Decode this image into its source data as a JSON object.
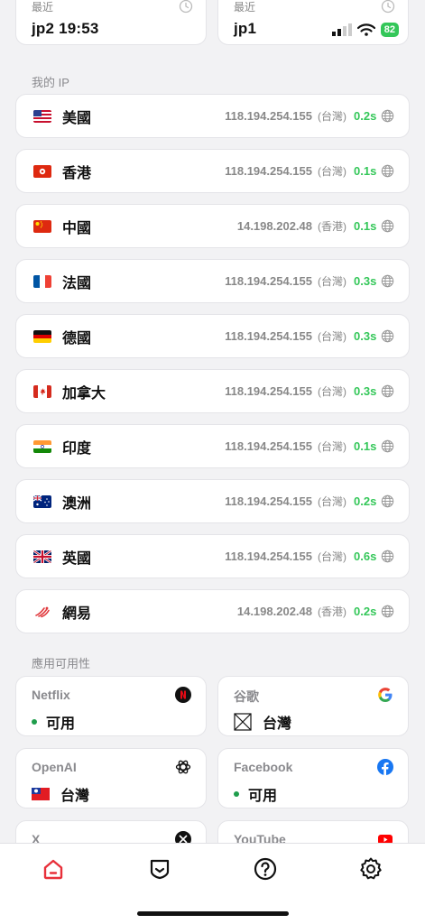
{
  "recent": [
    {
      "label": "最近",
      "main": "jp2 19:53"
    },
    {
      "label": "最近",
      "main": "jp1",
      "battery": "82"
    }
  ],
  "sections": {
    "my_ip": "我的 IP",
    "availability": "應用可用性"
  },
  "ip_rows": [
    {
      "country": "美國",
      "flag": "us-flag-icon",
      "ip": "118.194.254.155",
      "region": "(台灣)",
      "latency": "0.2s"
    },
    {
      "country": "香港",
      "flag": "hk-flag-icon",
      "ip": "118.194.254.155",
      "region": "(台灣)",
      "latency": "0.1s"
    },
    {
      "country": "中國",
      "flag": "cn-flag-icon",
      "ip": "14.198.202.48",
      "region": "(香港)",
      "latency": "0.1s"
    },
    {
      "country": "法國",
      "flag": "fr-flag-icon",
      "ip": "118.194.254.155",
      "region": "(台灣)",
      "latency": "0.3s"
    },
    {
      "country": "德國",
      "flag": "de-flag-icon",
      "ip": "118.194.254.155",
      "region": "(台灣)",
      "latency": "0.3s"
    },
    {
      "country": "加拿大",
      "flag": "ca-flag-icon",
      "ip": "118.194.254.155",
      "region": "(台灣)",
      "latency": "0.3s"
    },
    {
      "country": "印度",
      "flag": "in-flag-icon",
      "ip": "118.194.254.155",
      "region": "(台灣)",
      "latency": "0.1s"
    },
    {
      "country": "澳洲",
      "flag": "au-flag-icon",
      "ip": "118.194.254.155",
      "region": "(台灣)",
      "latency": "0.2s"
    },
    {
      "country": "英國",
      "flag": "gb-flag-icon",
      "ip": "118.194.254.155",
      "region": "(台灣)",
      "latency": "0.6s"
    },
    {
      "country": "網易",
      "flag": "netease-logo-icon",
      "ip": "14.198.202.48",
      "region": "(香港)",
      "latency": "0.2s"
    }
  ],
  "services": [
    {
      "name": "Netflix",
      "value": "可用",
      "logo": "netflix-logo-icon",
      "indicator": "green-dot"
    },
    {
      "name": "谷歌",
      "value": "台灣",
      "logo": "google-logo-icon",
      "indicator": "placeholder-flag-icon"
    },
    {
      "name": "OpenAI",
      "value": "台灣",
      "logo": "openai-logo-icon",
      "indicator": "tw-flag-icon"
    },
    {
      "name": "Facebook",
      "value": "可用",
      "logo": "facebook-logo-icon",
      "indicator": "green-dot"
    },
    {
      "name": "X",
      "value": "",
      "logo": "x-logo-icon"
    },
    {
      "name": "YouTube",
      "value": "",
      "logo": "youtube-logo-icon"
    }
  ],
  "tabs": [
    "home-icon",
    "shield-icon",
    "help-icon",
    "settings-icon"
  ],
  "colors": {
    "accent": "#e8303a",
    "success": "#34c759",
    "background": "#f2f2f4"
  }
}
